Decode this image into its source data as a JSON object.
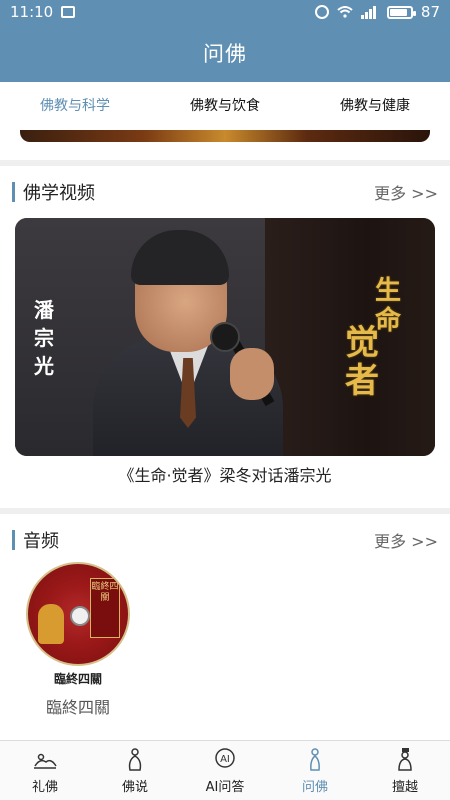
{
  "status_bar": {
    "time": "11:10",
    "battery": "87",
    "battery_level": 0.87
  },
  "app_bar": {
    "title": "问佛"
  },
  "tabs": [
    {
      "label": "佛教与科学",
      "active": true
    },
    {
      "label": "佛教与饮食",
      "active": false
    },
    {
      "label": "佛教与健康",
      "active": false
    }
  ],
  "video_section": {
    "title": "佛学视频",
    "more": "更多 >>",
    "video": {
      "side_text": "潘宗光",
      "art_line1": "生命",
      "art_line2": "觉者",
      "caption": "《生命·觉者》梁冬对话潘宗光"
    }
  },
  "audio_section": {
    "title": "音频",
    "more": "更多 >>",
    "item": {
      "cover_text": "臨終四關",
      "label": "臨終四關",
      "title": "臨終四關"
    }
  },
  "bottom_nav": [
    {
      "label": "礼佛",
      "icon": "bow-icon",
      "active": false
    },
    {
      "label": "佛说",
      "icon": "buddha-icon",
      "active": false
    },
    {
      "label": "AI问答",
      "icon": "ai-icon",
      "active": false
    },
    {
      "label": "问佛",
      "icon": "monk-icon",
      "active": true
    },
    {
      "label": "擅越",
      "icon": "scholar-icon",
      "active": false
    }
  ],
  "colors": {
    "primary": "#5f8fb3",
    "background": "#efefef"
  }
}
